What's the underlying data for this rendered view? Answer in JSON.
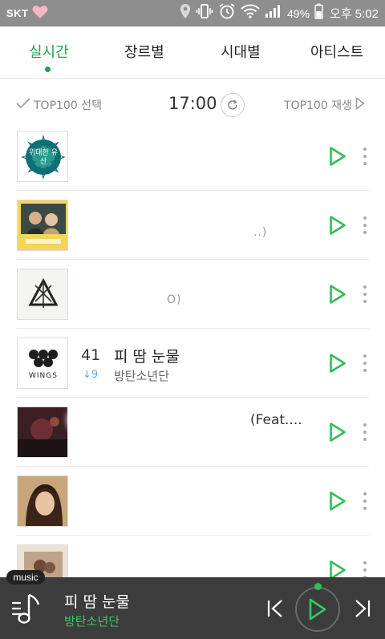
{
  "status_bar": {
    "carrier": "SKT",
    "battery_pct": "49%",
    "time": "오후 5:02",
    "icons": [
      "heart-icon",
      "location-icon",
      "vibrate-icon",
      "alarm-icon",
      "wifi-icon",
      "signal-icon",
      "battery-icon"
    ]
  },
  "tabs": [
    {
      "label": "실시간",
      "active": true
    },
    {
      "label": "장르별",
      "active": false
    },
    {
      "label": "시대별",
      "active": false
    },
    {
      "label": "아티스트",
      "active": false
    }
  ],
  "toolbar": {
    "select_label": "TOP100 선택",
    "chart_time": "17:00",
    "play_label": "TOP100 재생"
  },
  "rows": [
    {
      "rank": "",
      "title": "",
      "change": "",
      "artist": "",
      "cover": "위대한 유산"
    },
    {
      "rank": "",
      "title": "",
      "change": "",
      "artist": "",
      "cover": ""
    },
    {
      "rank": "",
      "title": "",
      "change": "",
      "artist": "",
      "cover": ""
    },
    {
      "rank": "41",
      "title": "피 땀 눈물",
      "change": "9",
      "change_dir": "down",
      "artist": "방탄소년단",
      "cover": "WINGS"
    },
    {
      "rank": "",
      "title": "",
      "change": "",
      "artist": "",
      "cover": ""
    },
    {
      "rank": "",
      "title": "",
      "change": "",
      "artist": "",
      "cover": ""
    },
    {
      "rank": "",
      "title": "",
      "change": "",
      "artist": "",
      "cover": ""
    }
  ],
  "faint_text": {
    "row5_title_tail": "(Feat....",
    "row2_tail": "..)",
    "row3_tail": "O)"
  },
  "player": {
    "tag": "music",
    "title": "피 땀 눈물",
    "artist": "방탄소년단"
  },
  "colors": {
    "accent": "#1aa64a",
    "player_bg": "#3c3c3c",
    "statusbar_bg": "#8e8e8e"
  }
}
